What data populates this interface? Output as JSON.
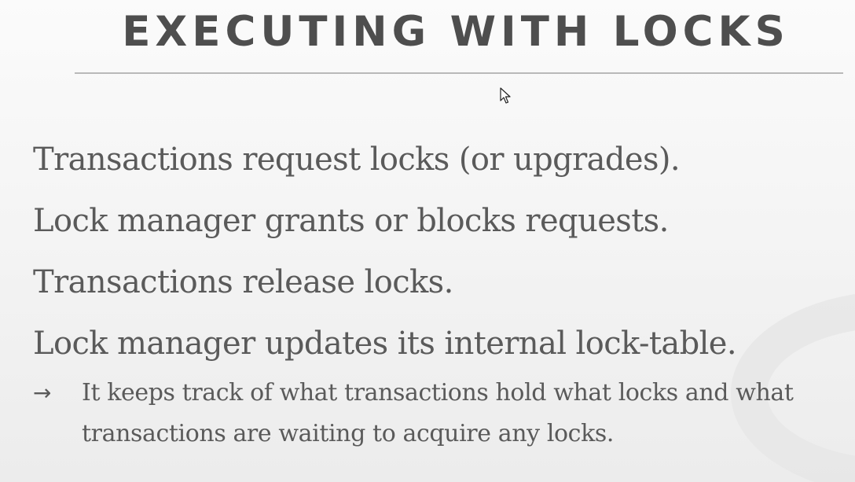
{
  "slide": {
    "title": "EXECUTING WITH LOCKS",
    "bullets": [
      "Transactions request locks (or upgrades).",
      "Lock manager grants or blocks requests.",
      "Transactions release locks.",
      "Lock manager updates its internal lock-table."
    ],
    "sub_bullet": {
      "marker": "→",
      "text": "It keeps track of what transactions hold what locks and what transactions are waiting to acquire any locks."
    }
  },
  "colors": {
    "text": "#5a5a5a",
    "title": "#4e4e4e",
    "rule": "#b9b9b9"
  },
  "icons": {
    "cursor": "mouse-pointer-icon"
  }
}
